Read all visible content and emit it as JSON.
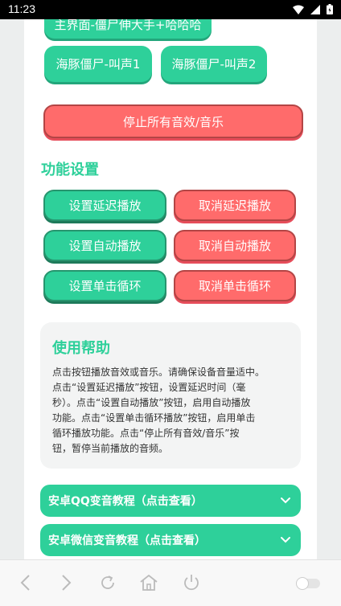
{
  "status_bar": {
    "time": "11:23"
  },
  "top_buttons": {
    "partial": "主界面-僵尸伸大手+哈哈哈",
    "dolphin1": "海豚僵尸-叫声1",
    "dolphin2": "海豚僵尸-叫声2"
  },
  "stop_all": "停止所有音效/音乐",
  "features": {
    "title": "功能设置",
    "set_delay": "设置延迟播放",
    "cancel_delay": "取消延迟播放",
    "set_auto": "设置自动播放",
    "cancel_auto": "取消自动播放",
    "set_loop": "设置单击循环",
    "cancel_loop": "取消单击循环"
  },
  "help": {
    "title": "使用帮助",
    "lines": [
      "点击按钮播放音效或音乐。请确保设备音量适中。",
      "点击“设置延迟播放”按钮，设置延迟时间（毫",
      "秒）。点击“设置自动播放”按钮，启用自动播放",
      "功能。点击“设置单击循环播放”按钮，启用单击",
      "循环播放功能。点击“停止所有音效/音乐”按",
      "钮，暂停当前播放的音频。"
    ]
  },
  "tutorials": {
    "qq": "安卓QQ变音教程（点击查看）",
    "wechat": "安卓微信变音教程（点击查看）"
  },
  "colors": {
    "accent": "#2ed09a",
    "danger": "#ff6b6b"
  },
  "nav_icons": [
    "back-icon",
    "forward-icon",
    "refresh-icon",
    "home-icon",
    "power-icon",
    "toggle-icon"
  ]
}
